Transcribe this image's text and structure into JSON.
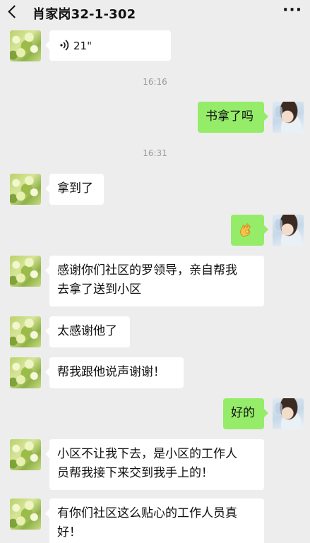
{
  "header": {
    "back_icon": "chevron-left-icon",
    "title": "肖家岗32-1-302",
    "more_icon": "more-dots-icon",
    "more_label": "···"
  },
  "messages": {
    "voice": {
      "duration": "21\"",
      "icon": "voice-wave-icon"
    },
    "time1": "16:16",
    "m1": "书拿了吗",
    "time2": "16:31",
    "m2": "拿到了",
    "m3_emoji": "ok-hand-emoji",
    "m4_line1": "感谢你们社区的罗领导，亲自帮我",
    "m4_line2": "去拿了送到小区",
    "m5": "太感谢他了",
    "m6": "帮我跟他说声谢谢！",
    "m7": "好的",
    "m8_line1": "小区不让我下去，是小区的工作人",
    "m8_line2": "员帮我接下来交到我手上的！",
    "m9_line1": "有你们社区这么贴心的工作人员真",
    "m9_line2": "好！"
  },
  "colors": {
    "background": "#ededed",
    "incoming_bubble": "#ffffff",
    "outgoing_bubble": "#95ec69",
    "timestamp": "#9a9a9a"
  }
}
